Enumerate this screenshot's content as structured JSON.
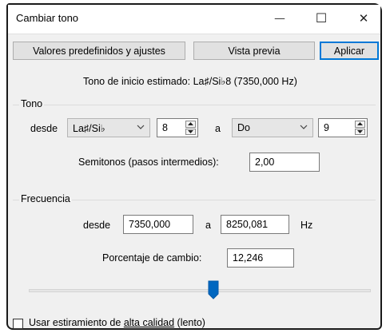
{
  "window": {
    "title": "Cambiar tono",
    "minimize_glyph": "—",
    "maximize_glyph": "☐",
    "close_glyph": "✕"
  },
  "toolbar": {
    "presets_label": "Valores predefinidos y ajustes",
    "preview_label": "Vista previa",
    "apply_label": "Aplicar"
  },
  "estimate_text": "Tono de inicio estimado: La♯/Si♭8 (7350,000 Hz)",
  "pitch": {
    "group_label": "Tono",
    "from_label": "desde",
    "from_note": "La♯/Si♭",
    "from_octave": "8",
    "to_label": "a",
    "to_note": "Do",
    "to_octave": "9",
    "semitones_label": "Semitonos (pasos intermedios):",
    "semitones_value": "2,00"
  },
  "frequency": {
    "group_label": "Frecuencia",
    "from_label": "desde",
    "from_value": "7350,000",
    "to_label": "a",
    "to_value": "8250,081",
    "unit": "Hz",
    "percent_label": "Porcentaje de cambio:",
    "percent_value": "12,246"
  },
  "slider": {
    "level_fraction": 0.54
  },
  "options": {
    "high_quality_prefix": "Usar estiramiento de ",
    "high_quality_underlined": "alta calidad",
    "high_quality_suffix": " (lento)",
    "high_quality_checked": false
  },
  "colors": {
    "accent": "#0078d7",
    "dialog_bg": "#f0f0f0",
    "slider_thumb": "#0067c0"
  },
  "icons": {
    "chevron": "chevron-down-icon",
    "spin_up": "spin-up-icon",
    "spin_down": "spin-down-icon"
  }
}
